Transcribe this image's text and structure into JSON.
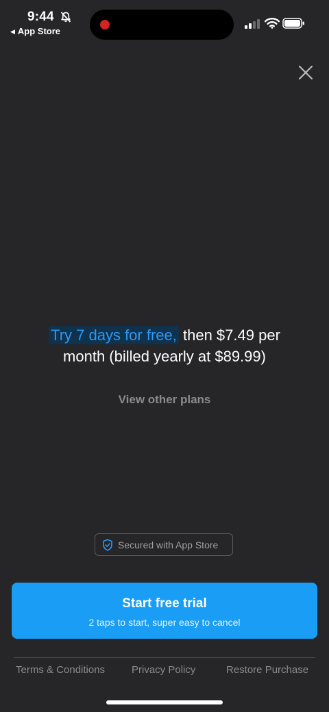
{
  "status_bar": {
    "time": "9:44",
    "back_app": "App Store",
    "icons": [
      "bell-slash-icon",
      "cellular-signal-icon",
      "wifi-icon",
      "battery-icon"
    ],
    "recording_color": "#d32424"
  },
  "paywall": {
    "offer_highlight": "Try 7 days for free,",
    "offer_rest_line1": " then $7.49 per",
    "offer_rest_line2": "month (billed yearly at $89.99)",
    "view_plans_label": "View other plans",
    "secured_label": "Secured with App Store",
    "cta_title": "Start free trial",
    "cta_subtitle": "2 taps to start, super easy to cancel"
  },
  "footer": {
    "terms": "Terms & Conditions",
    "privacy": "Privacy Policy",
    "restore": "Restore Purchase"
  },
  "colors": {
    "background": "#262528",
    "accent": "#199df5",
    "highlight_text": "#2c98f3",
    "muted_text": "#8b8a8f"
  }
}
